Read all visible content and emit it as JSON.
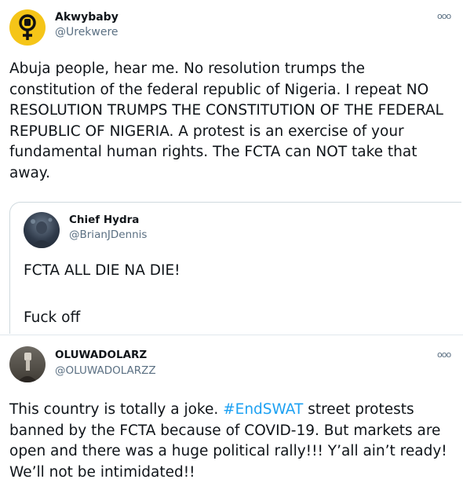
{
  "tweet1": {
    "name": "Akwybaby",
    "handle": "@Urekwere",
    "text": "Abuja people, hear me. No resolution trumps the constitution of the federal republic of Nigeria. I repeat NO RESOLUTION TRUMPS THE CONSTITUTION OF THE FEDERAL REPUBLIC OF NIGERIA. A protest is an exercise of your fundamental human rights. The FCTA can NOT take that away.",
    "avatar_icon": "female-symbol-fist-icon",
    "avatar_color": "#f5c518"
  },
  "quoted": {
    "name": "Chief Hydra",
    "handle": "@BrianJDennis",
    "line1": "FCTA ALL DIE NA DIE!",
    "line2": "Fuck off"
  },
  "tweet2": {
    "name": "OLUWADOLARZ",
    "handle": "@OLUWADOLARZZ",
    "text_pre": "This country is totally a joke. ",
    "hashtag": "#EndSWAT",
    "text_post": " street protests banned by the FCTA because of COVID-19. But markets are open and there was a huge political rally!!! Y’all ain’t ready! We’ll not be intimidated!!"
  },
  "more_glyph": "ooo",
  "colors": {
    "link": "#1da1f2",
    "secondary": "#5b7083",
    "text": "#0f1419"
  }
}
